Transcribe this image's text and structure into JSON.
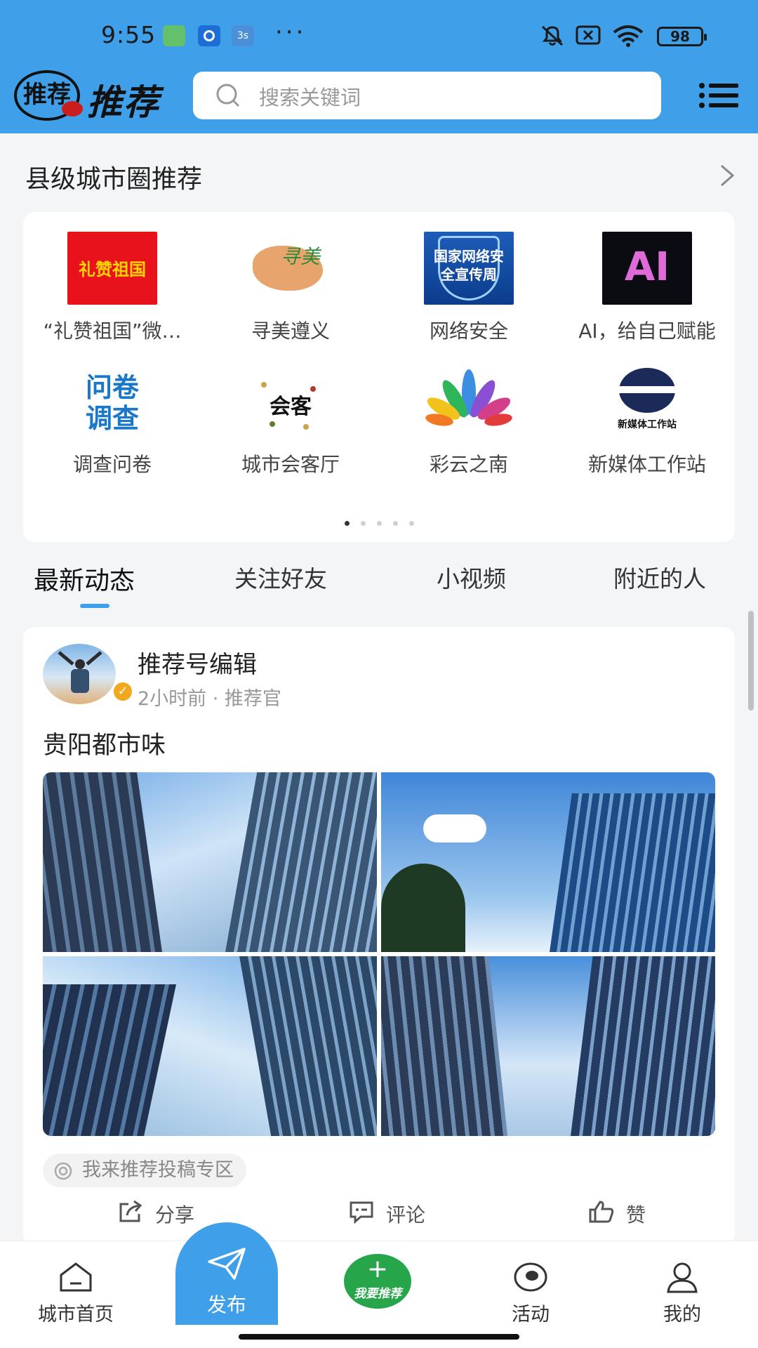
{
  "status_bar": {
    "time": "9:55",
    "extra_icon_label": "3s",
    "more": "···",
    "battery": "98"
  },
  "header": {
    "logo_mark": "推荐",
    "logo_text": "推荐",
    "search_placeholder": "搜索关键词"
  },
  "circle_section": {
    "title": "县级城市圈推荐",
    "items": [
      {
        "label": "“礼赞祖国”微…",
        "thumb_text": "礼赞祖国"
      },
      {
        "label": "寻美遵义",
        "thumb_text": "寻美"
      },
      {
        "label": "网络安全",
        "thumb_text": "国家网络安全宣传周"
      },
      {
        "label": "AI，给自己赋能",
        "thumb_text": "AI"
      },
      {
        "label": "调查问卷",
        "thumb_text": "问卷调查"
      },
      {
        "label": "城市会客厅",
        "thumb_text": "会客"
      },
      {
        "label": "彩云之南",
        "thumb_text": ""
      },
      {
        "label": "新媒体工作站",
        "thumb_text": "新媒体工作站"
      }
    ],
    "page_count": 5,
    "active_page": 1
  },
  "feed_tabs": [
    {
      "label": "最新动态",
      "active": true
    },
    {
      "label": "关注好友",
      "active": false
    },
    {
      "label": "小视频",
      "active": false
    },
    {
      "label": "附近的人",
      "active": false
    }
  ],
  "post": {
    "author": "推荐号编辑",
    "meta": "2小时前 · 推荐官",
    "title": "贵阳都市味",
    "photo_count": 4,
    "tag": "我来推荐投稿专区",
    "actions": {
      "share": "分享",
      "comment": "评论",
      "like": "赞"
    }
  },
  "bottom_nav": {
    "home": "城市首页",
    "publish": "发布",
    "recommend": "我要推荐",
    "activity": "活动",
    "mine": "我的"
  },
  "colors": {
    "primary": "#3f9fe9",
    "recommend_green": "#27a54a",
    "badge_orange": "#f0a81e"
  }
}
